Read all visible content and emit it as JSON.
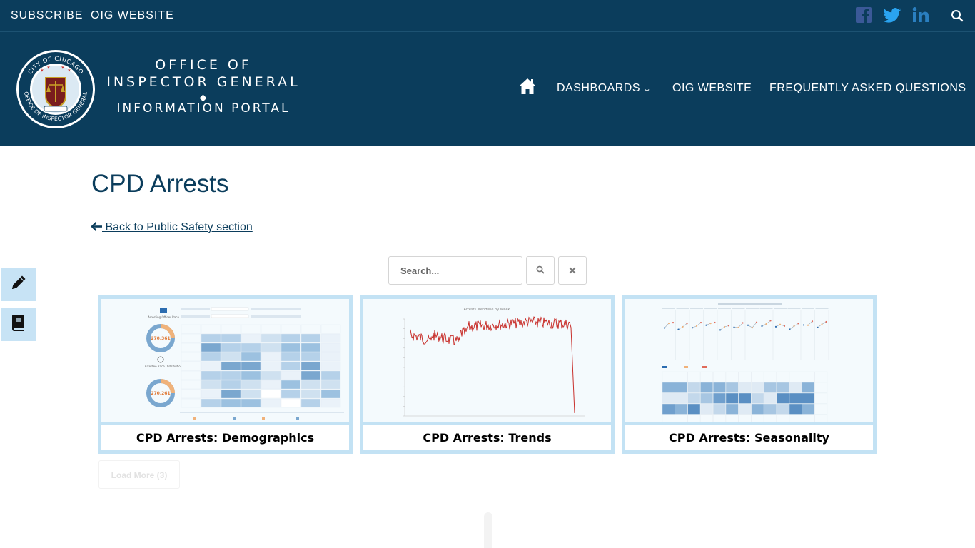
{
  "topbar": {
    "subscribe": "SUBSCRIBE",
    "oig_website": "OIG WEBSITE",
    "social": [
      "facebook-icon",
      "twitter-icon",
      "linkedin-icon"
    ],
    "search_icon": "search-icon"
  },
  "logo": {
    "seal_top": "CITY OF CHICAGO",
    "seal_bottom": "OFFICE OF INSPECTOR GENERAL",
    "line1": "OFFICE OF",
    "line2": "INSPECTOR GENERAL",
    "line3": "INFORMATION PORTAL"
  },
  "nav": {
    "home_icon": "home-icon",
    "dashboards": "DASHBOARDS",
    "oig_website": "OIG WEBSITE",
    "faq": "FREQUENTLY ASKED QUESTIONS"
  },
  "page": {
    "title": "CPD Arrests",
    "back_link": " Back to Public Safety section"
  },
  "search": {
    "placeholder": "Search..."
  },
  "cards": [
    {
      "label": "CPD Arrests: Demographics",
      "thumb_total": "270,361",
      "thumb_total2": "270,261"
    },
    {
      "label": "CPD Arrests: Trends",
      "thumb_title": "Arrests Trendline by Week"
    },
    {
      "label": "CPD Arrests: Seasonality"
    }
  ],
  "load_more": "Load More (3)",
  "colors": {
    "header_bg": "#0b3d5c",
    "card_border": "#c3e2f4",
    "title_color": "#0b3d5c",
    "trend_line": "#c8302c"
  }
}
